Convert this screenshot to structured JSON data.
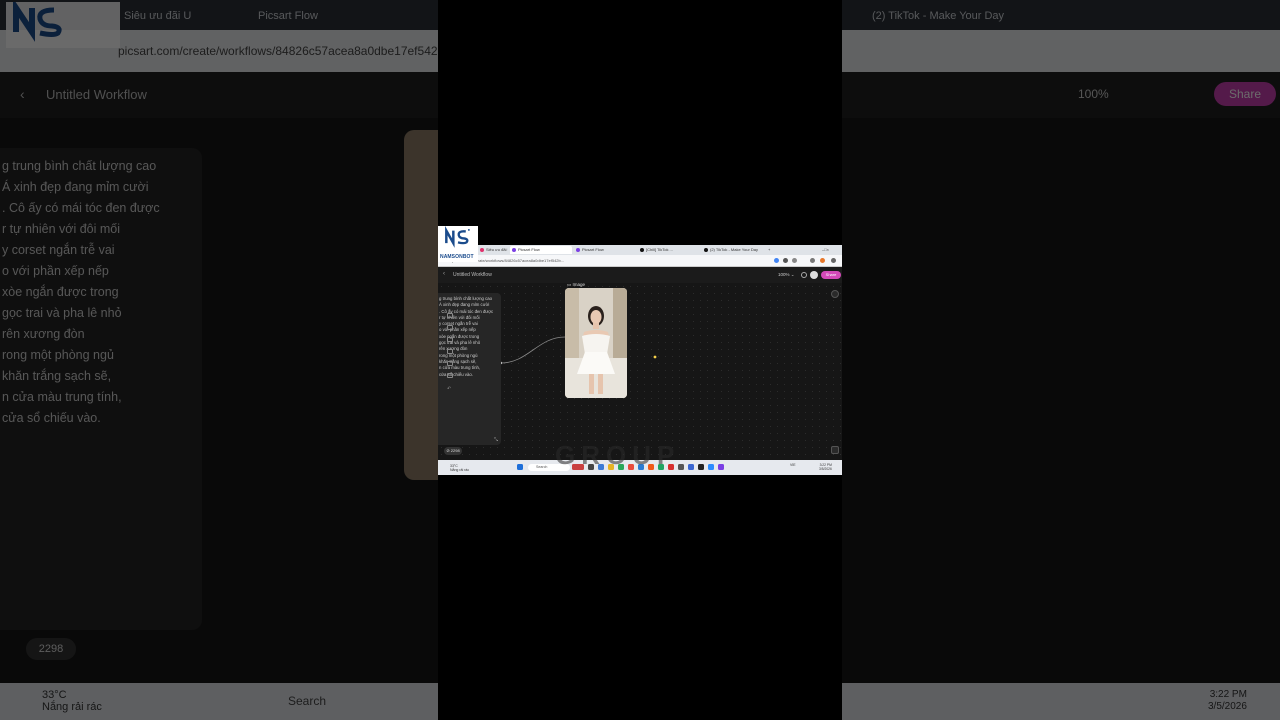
{
  "branding": {
    "logo_text": "NAMSONBOT",
    "logo_initials": "NS",
    "watermark_text": "GROUP"
  },
  "browser": {
    "tabs": [
      {
        "label": "Siêu ưu đãi U",
        "active": false,
        "color": "#e1306c"
      },
      {
        "label": "Picsart Flow",
        "active": true,
        "color": "#7b3fe4"
      },
      {
        "label": "Picsart Flow",
        "active": false,
        "color": "#7b3fe4"
      },
      {
        "label": "[Chill] TikTok ...",
        "active": false,
        "color": "#111111"
      },
      {
        "label": "(2) TikTok - Make Your Day",
        "active": false,
        "color": "#111111"
      }
    ],
    "url": "picsart.com/create/workflows/84826c57acea8a0dbe17ef542b..."
  },
  "workflow": {
    "title": "Untitled Workflow",
    "zoom": "100%",
    "share_label": "Share",
    "prompt_text": "g trung bình chất lượng cao\nÁ xinh đẹp đang mỉm cười\n. Cô ấy có mái tóc đen được\nr tự nhiên với đôi mối\ny corset ngắn trễ vai\no với phần xếp nếp\nxòe ngắn được trong\ngọc trai và pha lê nhỏ\nrên xương đòn\nrong một phòng ngủ\nkhăn trắng sạch sẽ,\nn cửa màu trung tính,\ncửa sổ chiếu vào.",
    "credits": "2298",
    "image_node_label": "Image"
  },
  "taskbar": {
    "weather_temp": "33°C",
    "weather_desc": "Nắng rải rác",
    "search_placeholder": "Search",
    "language": "VIE",
    "time": "3:22 PM",
    "date": "3/5/2026"
  },
  "colors": {
    "accent": "#d44ab8",
    "canvas": "#161616",
    "panel": "#262626"
  }
}
